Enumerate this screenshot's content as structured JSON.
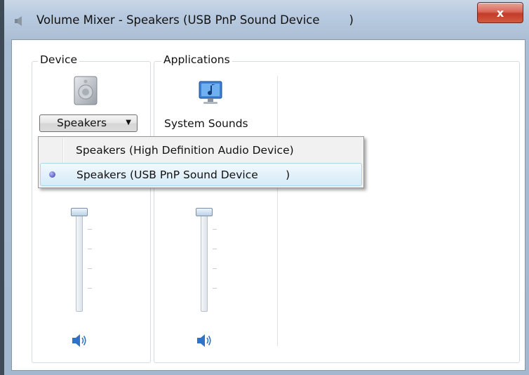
{
  "window": {
    "title": "Volume Mixer - Speakers (USB PnP Sound Device        )",
    "close_glyph": "x"
  },
  "device": {
    "group_label": "Device",
    "dropdown_label": "Speakers",
    "dropdown_arrow": "▼"
  },
  "applications": {
    "group_label": "Applications",
    "items": [
      {
        "name": "System Sounds"
      }
    ]
  },
  "dropdown_menu": {
    "items": [
      {
        "label": "Speakers (High Definition Audio Device)",
        "selected": false
      },
      {
        "label": "Speakers (USB PnP Sound Device        )",
        "selected": true
      }
    ]
  },
  "colors": {
    "accent": "#2f72c8",
    "selection_border": "#a8d8eb",
    "close_red": "#c23b2a"
  }
}
